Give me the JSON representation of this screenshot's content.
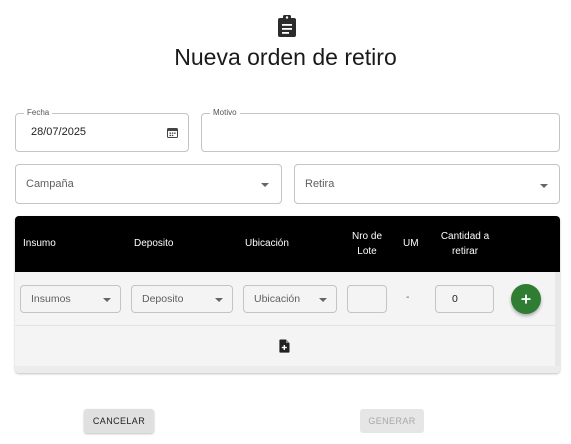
{
  "header": {
    "icon": "clipboard-icon",
    "title": "Nueva orden de retiro"
  },
  "form": {
    "fecha": {
      "label": "Fecha",
      "value": "28/07/2025",
      "icon": "calendar-icon"
    },
    "motivo": {
      "label": "Motivo",
      "value": ""
    },
    "campana": {
      "placeholder": "Campaña"
    },
    "retira": {
      "placeholder": "Retira"
    }
  },
  "table": {
    "headers": {
      "insumo": "Insumo",
      "deposito": "Deposito",
      "ubicacion": "Ubicación",
      "nro_lote": "Nro de Lote",
      "um": "UM",
      "cantidad": "Cantidad a retirar"
    },
    "row": {
      "insumos": "Insumos",
      "deposito": "Deposito",
      "ubicacion": "Ubicación",
      "lote": "",
      "um": "-",
      "cantidad": "0",
      "add_icon": "plus-icon"
    },
    "footer_icon": "file-add-icon"
  },
  "actions": {
    "cancel": "CANCELAR",
    "generate": "GENERAR"
  },
  "colors": {
    "header_bg": "#000000",
    "add_button": "#2e7d32",
    "text": "#212121"
  }
}
